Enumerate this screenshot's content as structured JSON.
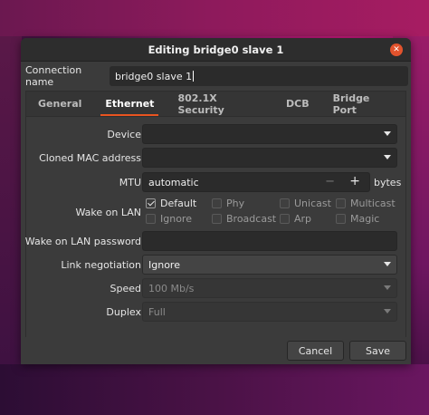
{
  "window": {
    "title": "Editing bridge0 slave 1"
  },
  "connection": {
    "label": "Connection name",
    "value": "bridge0 slave 1"
  },
  "tabs": [
    {
      "label": "General"
    },
    {
      "label": "Ethernet"
    },
    {
      "label": "802.1X Security"
    },
    {
      "label": "DCB"
    },
    {
      "label": "Bridge Port"
    }
  ],
  "ethernet": {
    "device": {
      "label": "Device",
      "value": ""
    },
    "cloned_mac": {
      "label": "Cloned MAC address",
      "value": ""
    },
    "mtu": {
      "label": "MTU",
      "value": "automatic",
      "minus": "−",
      "plus": "+",
      "unit": "bytes"
    },
    "wol": {
      "label": "Wake on LAN",
      "options": {
        "default": "Default",
        "phy": "Phy",
        "unicast": "Unicast",
        "multicast": "Multicast",
        "ignore": "Ignore",
        "broadcast": "Broadcast",
        "arp": "Arp",
        "magic": "Magic"
      }
    },
    "wol_password": {
      "label": "Wake on LAN password",
      "value": ""
    },
    "link_negotiation": {
      "label": "Link negotiation",
      "value": "Ignore"
    },
    "speed": {
      "label": "Speed",
      "value": "100 Mb/s"
    },
    "duplex": {
      "label": "Duplex",
      "value": "Full"
    }
  },
  "buttons": {
    "cancel": "Cancel",
    "save": "Save"
  },
  "colors": {
    "accent": "#e95420",
    "close": "#e2532d"
  }
}
